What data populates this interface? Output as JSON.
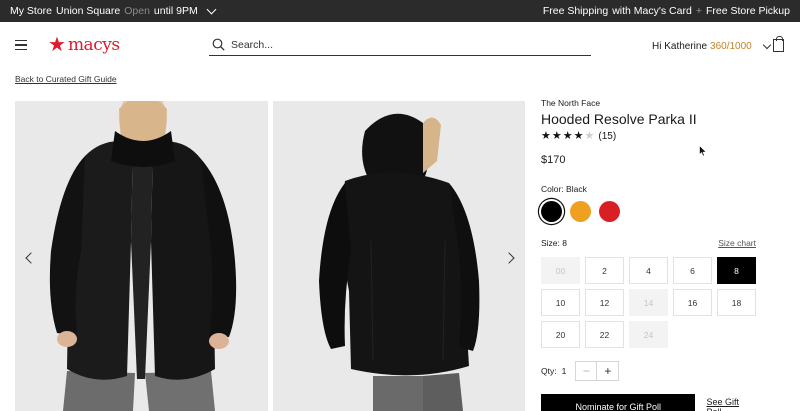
{
  "topbar": {
    "store_prefix": "My Store",
    "store_name": "Union Square",
    "status": "Open",
    "hours": "until 9PM",
    "free_shipping": "Free Shipping",
    "shipping_suffix": "with Macy's Card",
    "separator": "+",
    "store_pickup": "Free Store Pickup"
  },
  "header": {
    "logo_text": "macys",
    "search_placeholder": "Search...",
    "greeting": "Hi Katherine",
    "points": "360/1000"
  },
  "back_link": "Back to Curated Gift Guide",
  "product": {
    "brand": "The North Face",
    "title": "Hooded Resolve Parka II",
    "rating": 4,
    "rating_max": 5,
    "review_count": "(15)",
    "price": "$170",
    "color_label": "Color: Black",
    "colors": [
      {
        "name": "Black",
        "hex": "#000000",
        "selected": true
      },
      {
        "name": "Orange",
        "hex": "#f0a020",
        "selected": false
      },
      {
        "name": "Red",
        "hex": "#d91f26",
        "selected": false
      }
    ],
    "size_label": "Size: 8",
    "size_chart_label": "Size chart",
    "sizes": [
      {
        "label": "00",
        "state": "disabled"
      },
      {
        "label": "2",
        "state": "available"
      },
      {
        "label": "4",
        "state": "available"
      },
      {
        "label": "6",
        "state": "available"
      },
      {
        "label": "8",
        "state": "selected"
      },
      {
        "label": "10",
        "state": "available"
      },
      {
        "label": "12",
        "state": "available"
      },
      {
        "label": "14",
        "state": "disabled"
      },
      {
        "label": "16",
        "state": "available"
      },
      {
        "label": "18",
        "state": "available"
      },
      {
        "label": "20",
        "state": "available"
      },
      {
        "label": "22",
        "state": "available"
      },
      {
        "label": "24",
        "state": "disabled"
      }
    ],
    "qty_label": "Qty:",
    "qty_value": "1",
    "qty_minus": "−",
    "qty_plus": "+",
    "nominate_label": "Nominate for Gift Poll",
    "see_poll_label": "See Gift Poll"
  },
  "colors": {
    "brand_red": "#e11a2c",
    "points_gold": "#c5822b",
    "topbar_bg": "#2b2b2b"
  }
}
